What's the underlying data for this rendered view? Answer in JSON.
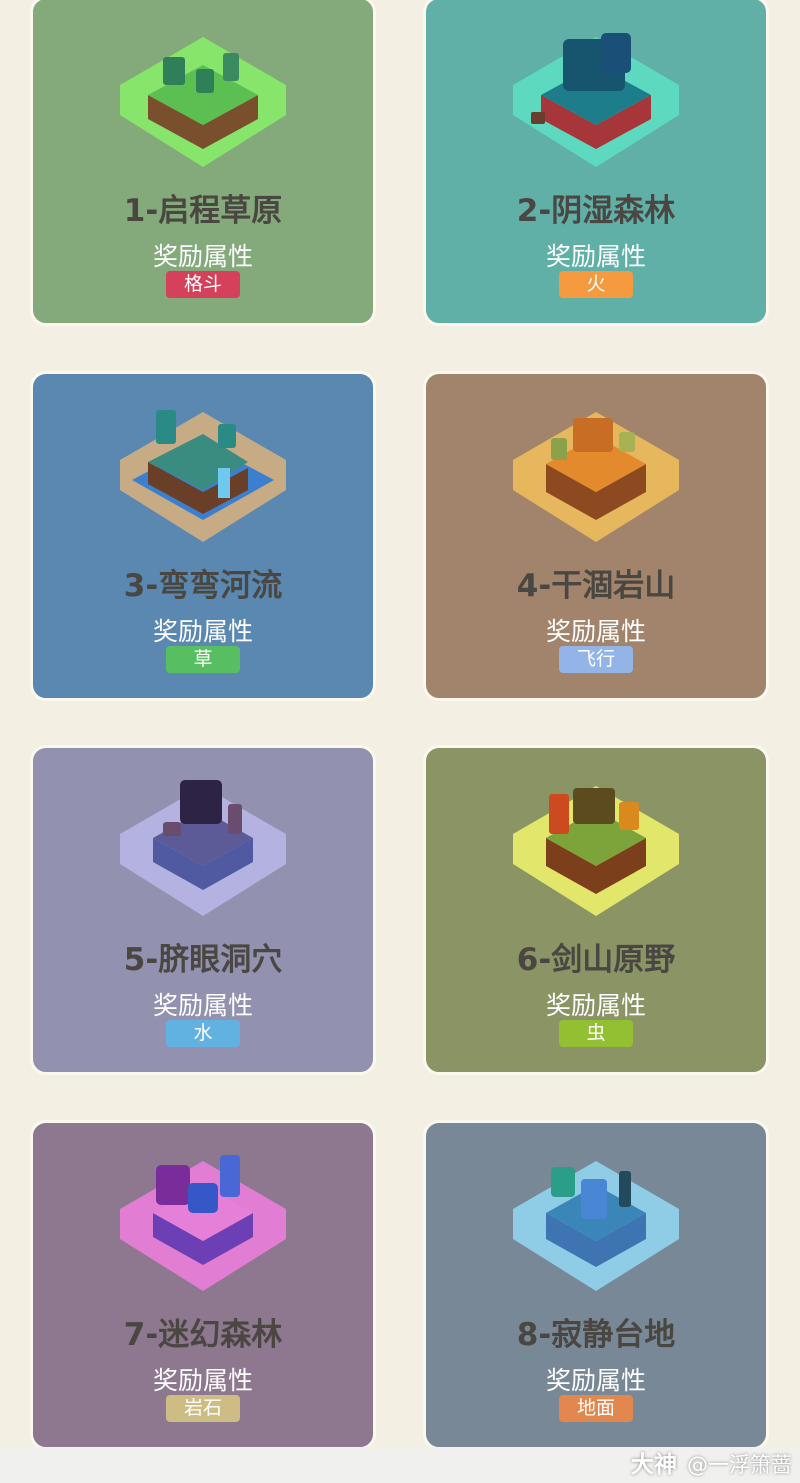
{
  "cards": [
    {
      "title": "1-启程草原",
      "reward_label": "奖励属性",
      "type_label": "格斗",
      "card_color": "#84a97b",
      "badge_color": "#d5405a",
      "glow_color": "#88f06a",
      "soil_color": "#7a4f2d",
      "top_color": "#5cbf52",
      "icon": "grassland-island-icon"
    },
    {
      "title": "2-阴湿森林",
      "reward_label": "奖励属性",
      "type_label": "火",
      "card_color": "#60b0a8",
      "badge_color": "#f59a3e",
      "glow_color": "#5de0c4",
      "soil_color": "#a6363a",
      "top_color": "#1e7d8a",
      "icon": "forest-island-icon"
    },
    {
      "title": "3-弯弯河流",
      "reward_label": "奖励属性",
      "type_label": "草",
      "card_color": "#5a88b1",
      "badge_color": "#58be62",
      "glow_color": "#d9b27e",
      "soil_color": "#6a3f28",
      "top_color": "#3b8c80",
      "icon": "river-island-icon"
    },
    {
      "title": "4-干涸岩山",
      "reward_label": "奖励属性",
      "type_label": "飞行",
      "card_color": "#a1846b",
      "badge_color": "#93b4e6",
      "glow_color": "#f3c05b",
      "soil_color": "#8d4a21",
      "top_color": "#e38b2c",
      "icon": "rock-mountain-island-icon"
    },
    {
      "title": "5-脐眼洞穴",
      "reward_label": "奖励属性",
      "type_label": "水",
      "card_color": "#9291b0",
      "badge_color": "#62b2e1",
      "glow_color": "#bab7ea",
      "soil_color": "#4f5aa0",
      "top_color": "#2d2445",
      "icon": "cave-island-icon"
    },
    {
      "title": "6-剑山原野",
      "reward_label": "奖励属性",
      "type_label": "虫",
      "card_color": "#8a9464",
      "badge_color": "#93bf33",
      "glow_color": "#f1f56b",
      "soil_color": "#7b3f1c",
      "top_color": "#7da43a",
      "icon": "sword-field-island-icon"
    },
    {
      "title": "7-迷幻森林",
      "reward_label": "奖励属性",
      "type_label": "岩石",
      "card_color": "#8d788f",
      "badge_color": "#cdbc84",
      "glow_color": "#f17ee0",
      "soil_color": "#6d3fb4",
      "top_color": "#8c3fc6",
      "icon": "psychedelic-forest-island-icon"
    },
    {
      "title": "8-寂静台地",
      "reward_label": "奖励属性",
      "type_label": "地面",
      "card_color": "#798896",
      "badge_color": "#e2874e",
      "glow_color": "#93d8f5",
      "soil_color": "#3f74b3",
      "top_color": "#3a86b8",
      "icon": "silent-plateau-island-icon"
    }
  ],
  "watermark": {
    "brand": "大神",
    "handle": "@一浮箫蔷"
  }
}
